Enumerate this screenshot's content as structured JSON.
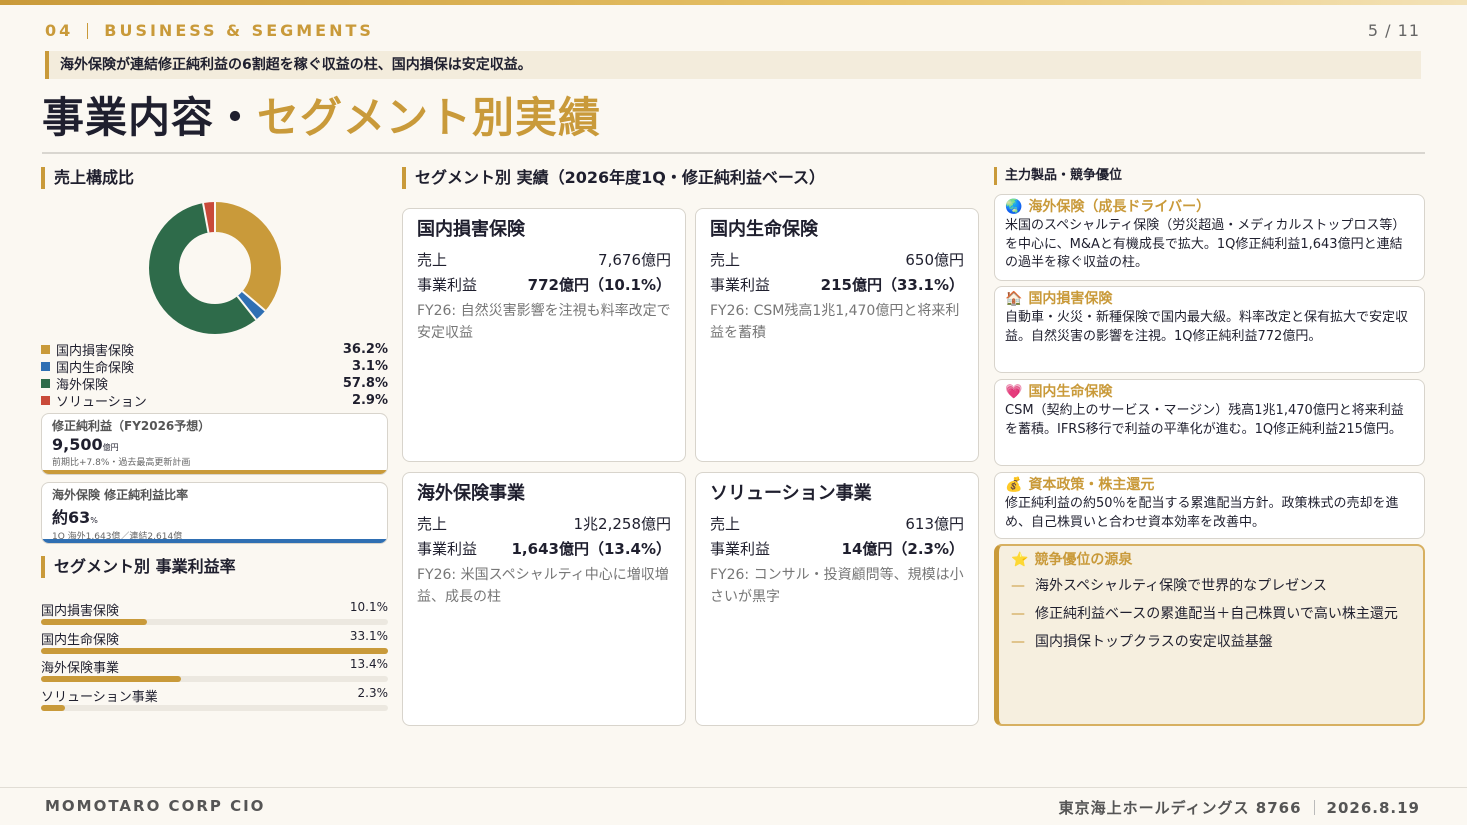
{
  "header": {
    "section_num": "04",
    "section_label": "BUSINESS & SEGMENTS",
    "page": "5 / 11",
    "lead": "海外保険が連結修正純利益の6割超を稼ぐ収益の柱、国内損保は安定収益。",
    "title_main": "事業内容・",
    "title_accent": "セグメント別実績"
  },
  "left": {
    "composition_heading": "売上構成比",
    "chart_data": {
      "type": "pie",
      "categories": [
        "国内損害保険",
        "国内生命保険",
        "海外保険",
        "ソリューション"
      ],
      "values": [
        36.2,
        3.1,
        57.8,
        2.9
      ],
      "colors": [
        "#c99a3a",
        "#2f6fb3",
        "#2e6b4a",
        "#c94a3a"
      ],
      "labels": [
        "36.2%",
        "3.1%",
        "57.8%",
        "2.9%"
      ]
    },
    "kpi1": {
      "label": "修正純利益（FY2026予想）",
      "value": "9,500",
      "unit": "億円",
      "note": "前期比+7.8%・過去最高更新計画",
      "bar_color": "#c99a3a"
    },
    "kpi2": {
      "label": "海外保険 修正純利益比率",
      "value": "約63",
      "unit": "%",
      "note": "1Q 海外1,643億／連結2,614億",
      "bar_color": "#2f6fb3"
    },
    "margin_heading": "セグメント別 事業利益率",
    "margins": [
      {
        "name": "国内損害保険",
        "label": "10.1%",
        "value": 10.1
      },
      {
        "name": "国内生命保険",
        "label": "33.1%",
        "value": 33.1
      },
      {
        "name": "海外保険事業",
        "label": "13.4%",
        "value": 13.4
      },
      {
        "name": "ソリューション事業",
        "label": "2.3%",
        "value": 2.3
      }
    ]
  },
  "middle": {
    "heading": "セグメント別 実績（2026年度1Q・修正純利益ベース）",
    "sales_label": "売上",
    "profit_label": "事業利益",
    "cards": [
      {
        "name": "国内損害保険",
        "sales": "7,676億円",
        "profit": "772億円（10.1%）",
        "note": "FY26: 自然災害影響を注視も料率改定で安定収益"
      },
      {
        "name": "国内生命保険",
        "sales": "650億円",
        "profit": "215億円（33.1%）",
        "note": "FY26: CSM残高1兆1,470億円と将来利益を蓄積"
      },
      {
        "name": "海外保険事業",
        "sales": "1兆2,258億円",
        "profit": "1,643億円（13.4%）",
        "note": "FY26: 米国スペシャルティ中心に増収増益、成長の柱"
      },
      {
        "name": "ソリューション事業",
        "sales": "613億円",
        "profit": "14億円（2.3%）",
        "note": "FY26: コンサル・投資顧問等、規模は小さいが黒字"
      }
    ]
  },
  "right": {
    "heading": "主力製品・競争優位",
    "items": [
      {
        "icon": "🌏",
        "title": "海外保険（成長ドライバー）",
        "body": "米国のスペシャルティ保険（労災超過・メディカルストップロス等）を中心に、M&Aと有機成長で拡大。1Q修正純利益1,643億円と連結の過半を稼ぐ収益の柱。"
      },
      {
        "icon": "🏠",
        "title": "国内損害保険",
        "body": "自動車・火災・新種保険で国内最大級。料率改定と保有拡大で安定収益。自然災害の影響を注視。1Q修正純利益772億円。"
      },
      {
        "icon": "💗",
        "title": "国内生命保険",
        "body": "CSM（契約上のサービス・マージン）残高1兆1,470億円と将来利益を蓄積。IFRS移行で利益の平準化が進む。1Q修正純利益215億円。"
      },
      {
        "icon": "💰",
        "title": "資本政策・株主還元",
        "body": "修正純利益の約50％を配当する累進配当方針。政策株式の売却を進め、自己株買いと合わせ資本効率を改善中。"
      }
    ],
    "advantage": {
      "icon": "⭐",
      "title": "競争優位の源泉",
      "points": [
        "海外スペシャルティ保険で世界的なプレゼンス",
        "修正純利益ベースの累進配当＋自己株買いで高い株主還元",
        "国内損保トップクラスの安定収益基盤"
      ],
      "dash": "—"
    }
  },
  "footer": {
    "left": "MOMOTARO CORP CIO",
    "company": "東京海上ホールディングス 8766",
    "date": "2026.8.19"
  }
}
